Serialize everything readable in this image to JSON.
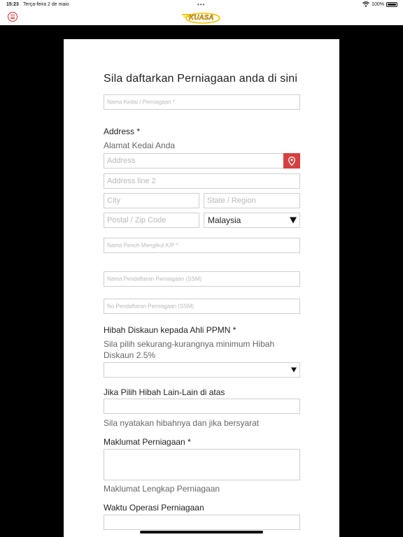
{
  "status_bar": {
    "time": "15:23",
    "date": "Terça-feira 2 de maio",
    "battery": "100%"
  },
  "header": {
    "logo_text": "KUASA"
  },
  "form": {
    "title": "Sila  daftarkan  Perniagaan  anda di sini",
    "shop_name_placeholder": "Nama Kedai / Perniagaan *",
    "address_label": "Address *",
    "address_hint": "Alamat  Kedai Anda",
    "address_placeholder": "Address",
    "address_line2_placeholder": "Address line 2",
    "city_placeholder": "City",
    "state_placeholder": "State /  Region",
    "postal_placeholder": "Postal / Zip Code",
    "country_value": "Malaysia",
    "full_name_placeholder": "Nama Penuh Mengikut K/P *",
    "ssm_name_placeholder": "Nama Pendaftaran Perniagaan (SSM)",
    "ssm_number_placeholder": "No Pendaftaran Perniagaan (SSM)",
    "discount_label": "Hibah  Diskaun kepada Ahli  PPMN *",
    "discount_hint_line1": "Sila pilih sekurang-kurangnya minimum  Hibah",
    "discount_hint_line2": "Diskaun 2.5%",
    "other_label": "Jika  Pilih  Hibah  Lain-Lain di atas",
    "other_hint": "Sila nyatakan hibahnya dan jika bersyarat",
    "business_info_label": "Maklumat  Perniagaan *",
    "business_info_hint": "Maklumat  Lengkap  Perniagaan",
    "hours_label": "Waktu Operasi   Perniagaan"
  },
  "colors": {
    "accent_red": "#d64040",
    "logo_yellow": "#f2c300"
  }
}
